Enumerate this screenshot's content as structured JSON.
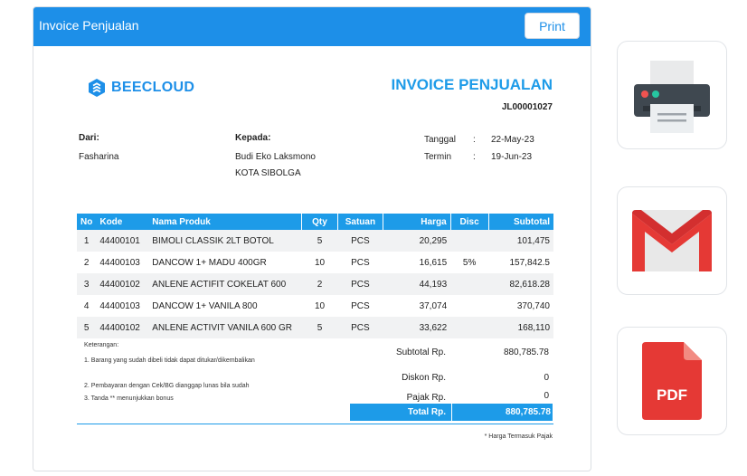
{
  "header": {
    "title": "Invoice Penjualan",
    "print_label": "Print"
  },
  "logo": {
    "text": "BEECLOUD"
  },
  "invoice": {
    "heading": "INVOICE PENJUALAN",
    "number": "JL00001027"
  },
  "from": {
    "label": "Dari:",
    "name": "Fasharina"
  },
  "to": {
    "label": "Kepada:",
    "name": "Budi Eko Laksmono",
    "city": "KOTA SIBOLGA"
  },
  "dates": {
    "date_label": "Tanggal",
    "date_sep": ":",
    "date_value": "22-May-23",
    "due_label": "Termin",
    "due_sep": ":",
    "due_value": "19-Jun-23"
  },
  "table": {
    "headers": [
      "No",
      "Kode",
      "Nama Produk",
      "Qty",
      "Satuan",
      "Harga",
      "Disc",
      "Subtotal"
    ],
    "rows": [
      [
        "1",
        "44400101",
        "BIMOLI CLASSIK 2LT BOTOL",
        "5",
        "PCS",
        "20,295",
        "",
        "101,475"
      ],
      [
        "2",
        "44400103",
        "DANCOW 1+ MADU 400GR",
        "10",
        "PCS",
        "16,615",
        "5%",
        "157,842.5"
      ],
      [
        "3",
        "44400102",
        "ANLENE ACTIFIT COKELAT 600",
        "2",
        "PCS",
        "44,193",
        "",
        "82,618.28"
      ],
      [
        "4",
        "44400103",
        "DANCOW 1+ VANILA 800",
        "10",
        "PCS",
        "37,074",
        "",
        "370,740"
      ],
      [
        "5",
        "44400102",
        "ANLENE ACTIVIT VANILA 600 GR",
        "5",
        "PCS",
        "33,622",
        "",
        "168,110"
      ]
    ]
  },
  "notes": {
    "title": "Keterangan:",
    "line1": "1. Barang yang sudah dibeli tidak dapat ditukar/dikembalikan",
    "line2": "2. Pembayaran dengan Cek/BG dianggap lunas bila sudah",
    "line3": "3. Tanda ** menunjukkan bonus"
  },
  "summary": {
    "subtotal_label": "Subtotal Rp.",
    "subtotal_value": "880,785.78",
    "discount_label": "Diskon Rp.",
    "discount_value": "0",
    "tax_label": "Pajak Rp.",
    "tax_value": "0",
    "total_label": "Total Rp.",
    "total_value": "880,785.78"
  },
  "footnote": "* Harga Termasuk Pajak",
  "colors": {
    "primary": "#1d8fe8",
    "table_header": "#1d9be8",
    "gmail_red": "#e53935",
    "pdf_red": "#e53935"
  },
  "side_icons": [
    "printer-icon",
    "gmail-icon",
    "pdf-icon"
  ],
  "pdf_icon_text": "PDF"
}
